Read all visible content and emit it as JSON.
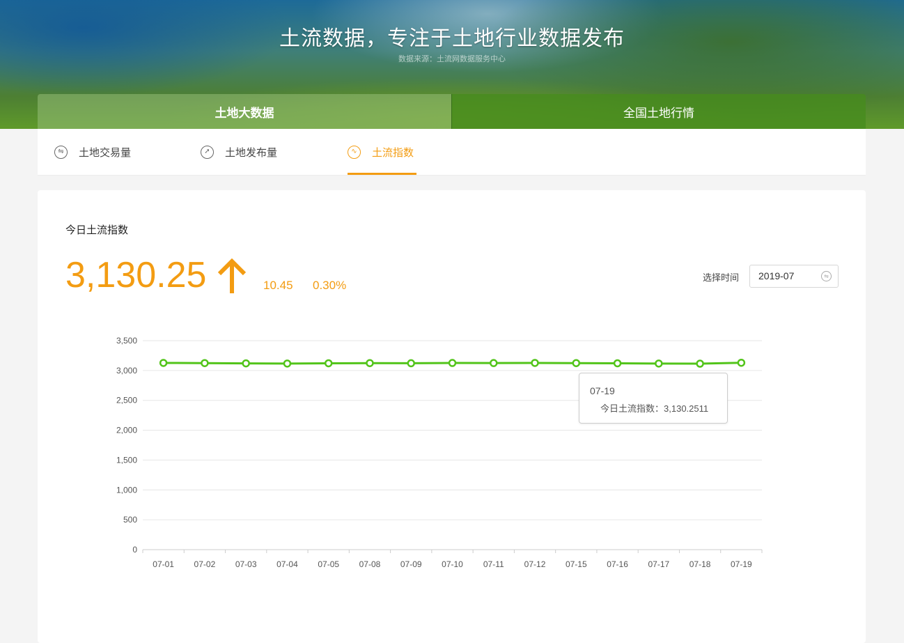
{
  "header": {
    "title": "土流数据，专注于土地行业数据发布",
    "subtitle": "数据来源：土流网数据服务中心"
  },
  "main_tabs": [
    {
      "label": "土地大数据",
      "active": true
    },
    {
      "label": "全国土地行情",
      "active": false
    }
  ],
  "sub_tabs": [
    {
      "label": "土地交易量",
      "icon": "exchange-icon",
      "active": false
    },
    {
      "label": "土地发布量",
      "icon": "paper-plane-icon",
      "active": false
    },
    {
      "label": "土流指数",
      "icon": "trend-line-icon",
      "active": true
    }
  ],
  "index": {
    "title": "今日土流指数",
    "value": "3,130.25",
    "change": "10.45",
    "change_pct": "0.30%",
    "direction": "up"
  },
  "date_picker": {
    "label": "选择时间",
    "value": "2019-07",
    "icon": "switch-icon"
  },
  "tooltip": {
    "date": "07-19",
    "label": "今日土流指数：",
    "value": "3,130.2511"
  },
  "colors": {
    "accent": "#f39c12",
    "line": "#52c41a",
    "text": "#333333"
  },
  "chart_data": {
    "type": "line",
    "x": [
      "07-01",
      "07-02",
      "07-03",
      "07-04",
      "07-05",
      "07-08",
      "07-09",
      "07-10",
      "07-11",
      "07-12",
      "07-15",
      "07-16",
      "07-17",
      "07-18",
      "07-19"
    ],
    "series": [
      {
        "values": [
          3127,
          3124,
          3120,
          3117,
          3121,
          3124,
          3122,
          3126,
          3125,
          3127,
          3124,
          3121,
          3117,
          3115,
          3130.2511
        ]
      }
    ],
    "ylim": [
      0,
      3500
    ],
    "yticks": [
      "0",
      "500",
      "1,000",
      "1,500",
      "2,000",
      "2,500",
      "3,000",
      "3,500"
    ],
    "grid": true,
    "legend": "none"
  }
}
